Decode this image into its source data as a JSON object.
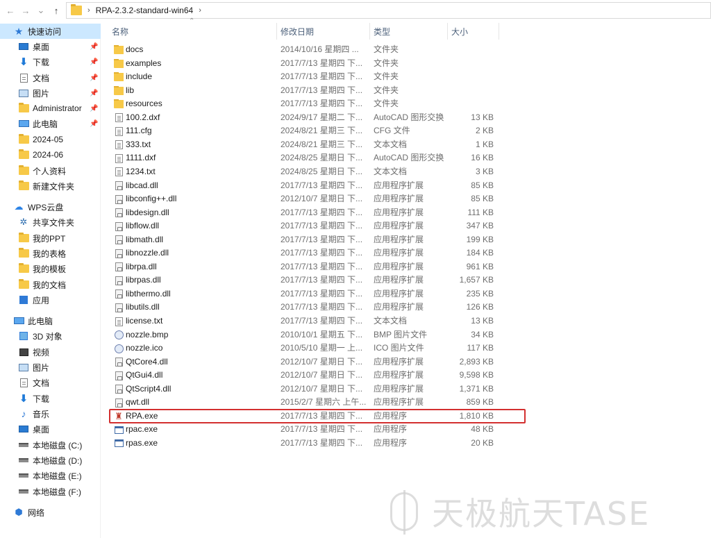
{
  "address": {
    "path": "RPA-2.3.2-standard-win64",
    "back_glyph": "←",
    "forward_glyph": "→",
    "history_glyph": "⌄",
    "up_glyph": "↑",
    "sep_glyph": "›"
  },
  "columns": {
    "name": "名称",
    "date": "修改日期",
    "type": "类型",
    "size": "大小",
    "sort_glyph": "⌃"
  },
  "sidebar": [
    {
      "label": "快速访问",
      "icon": "star-icon",
      "indent": 0,
      "pinned": false,
      "selected": true
    },
    {
      "label": "桌面",
      "icon": "desktop-icon",
      "indent": 1,
      "pinned": true,
      "selected": false
    },
    {
      "label": "下载",
      "icon": "download-icon",
      "indent": 1,
      "pinned": true,
      "selected": false
    },
    {
      "label": "文档",
      "icon": "document-icon",
      "indent": 1,
      "pinned": true,
      "selected": false
    },
    {
      "label": "图片",
      "icon": "pictures-icon",
      "indent": 1,
      "pinned": true,
      "selected": false
    },
    {
      "label": "Administrator",
      "icon": "folder-icon",
      "indent": 1,
      "pinned": true,
      "selected": false
    },
    {
      "label": "此电脑",
      "icon": "computer-icon",
      "indent": 1,
      "pinned": true,
      "selected": false
    },
    {
      "label": "2024-05",
      "icon": "folder-icon",
      "indent": 1,
      "pinned": false,
      "selected": false
    },
    {
      "label": "2024-06",
      "icon": "folder-icon",
      "indent": 1,
      "pinned": false,
      "selected": false
    },
    {
      "label": "个人资料",
      "icon": "folder-icon",
      "indent": 1,
      "pinned": false,
      "selected": false
    },
    {
      "label": "新建文件夹",
      "icon": "folder-icon",
      "indent": 1,
      "pinned": false,
      "selected": false
    },
    {
      "label": "WPS云盘",
      "icon": "cloud-icon",
      "indent": 0,
      "pinned": false,
      "selected": false
    },
    {
      "label": "共享文件夹",
      "icon": "share-icon",
      "indent": 1,
      "pinned": false,
      "selected": false
    },
    {
      "label": "我的PPT",
      "icon": "folder-icon",
      "indent": 1,
      "pinned": false,
      "selected": false
    },
    {
      "label": "我的表格",
      "icon": "folder-icon",
      "indent": 1,
      "pinned": false,
      "selected": false
    },
    {
      "label": "我的模板",
      "icon": "folder-icon",
      "indent": 1,
      "pinned": false,
      "selected": false
    },
    {
      "label": "我的文档",
      "icon": "folder-icon",
      "indent": 1,
      "pinned": false,
      "selected": false
    },
    {
      "label": "应用",
      "icon": "apps-icon",
      "indent": 1,
      "pinned": false,
      "selected": false
    },
    {
      "label": "此电脑",
      "icon": "computer-icon",
      "indent": 0,
      "pinned": false,
      "selected": false
    },
    {
      "label": "3D 对象",
      "icon": "3d-objects-icon",
      "indent": 1,
      "pinned": false,
      "selected": false
    },
    {
      "label": "视频",
      "icon": "video-icon",
      "indent": 1,
      "pinned": false,
      "selected": false
    },
    {
      "label": "图片",
      "icon": "pictures-icon",
      "indent": 1,
      "pinned": false,
      "selected": false
    },
    {
      "label": "文档",
      "icon": "document-icon",
      "indent": 1,
      "pinned": false,
      "selected": false
    },
    {
      "label": "下载",
      "icon": "download-icon",
      "indent": 1,
      "pinned": false,
      "selected": false
    },
    {
      "label": "音乐",
      "icon": "music-icon",
      "indent": 1,
      "pinned": false,
      "selected": false
    },
    {
      "label": "桌面",
      "icon": "desktop-icon",
      "indent": 1,
      "pinned": false,
      "selected": false
    },
    {
      "label": "本地磁盘 (C:)",
      "icon": "drive-icon",
      "indent": 1,
      "pinned": false,
      "selected": false
    },
    {
      "label": "本地磁盘 (D:)",
      "icon": "drive-icon",
      "indent": 1,
      "pinned": false,
      "selected": false
    },
    {
      "label": "本地磁盘 (E:)",
      "icon": "drive-icon",
      "indent": 1,
      "pinned": false,
      "selected": false
    },
    {
      "label": "本地磁盘 (F:)",
      "icon": "drive-icon",
      "indent": 1,
      "pinned": false,
      "selected": false
    },
    {
      "label": "网络",
      "icon": "network-icon",
      "indent": 0,
      "pinned": false,
      "selected": false
    }
  ],
  "pin_glyph": "📌",
  "files": [
    {
      "name": "docs",
      "date": "2014/10/16 星期四 ...",
      "type": "文件夹",
      "size": "",
      "icon": "folder-icon"
    },
    {
      "name": "examples",
      "date": "2017/7/13 星期四 下...",
      "type": "文件夹",
      "size": "",
      "icon": "folder-icon"
    },
    {
      "name": "include",
      "date": "2017/7/13 星期四 下...",
      "type": "文件夹",
      "size": "",
      "icon": "folder-icon"
    },
    {
      "name": "lib",
      "date": "2017/7/13 星期四 下...",
      "type": "文件夹",
      "size": "",
      "icon": "folder-icon"
    },
    {
      "name": "resources",
      "date": "2017/7/13 星期四 下...",
      "type": "文件夹",
      "size": "",
      "icon": "folder-icon"
    },
    {
      "name": "100.2.dxf",
      "date": "2024/9/17 星期二 下...",
      "type": "AutoCAD 图形交换",
      "size": "13 KB",
      "icon": "text-file-icon"
    },
    {
      "name": "111.cfg",
      "date": "2024/8/21 星期三 下...",
      "type": "CFG 文件",
      "size": "2 KB",
      "icon": "text-file-icon"
    },
    {
      "name": "333.txt",
      "date": "2024/8/21 星期三 下...",
      "type": "文本文档",
      "size": "1 KB",
      "icon": "text-file-icon"
    },
    {
      "name": "1111.dxf",
      "date": "2024/8/25 星期日 下...",
      "type": "AutoCAD 图形交换",
      "size": "16 KB",
      "icon": "text-file-icon"
    },
    {
      "name": "1234.txt",
      "date": "2024/8/25 星期日 下...",
      "type": "文本文档",
      "size": "3 KB",
      "icon": "text-file-icon"
    },
    {
      "name": "libcad.dll",
      "date": "2017/7/13 星期四 下...",
      "type": "应用程序扩展",
      "size": "85 KB",
      "icon": "dll-file-icon"
    },
    {
      "name": "libconfig++.dll",
      "date": "2012/10/7 星期日 下...",
      "type": "应用程序扩展",
      "size": "85 KB",
      "icon": "dll-file-icon"
    },
    {
      "name": "libdesign.dll",
      "date": "2017/7/13 星期四 下...",
      "type": "应用程序扩展",
      "size": "111 KB",
      "icon": "dll-file-icon"
    },
    {
      "name": "libflow.dll",
      "date": "2017/7/13 星期四 下...",
      "type": "应用程序扩展",
      "size": "347 KB",
      "icon": "dll-file-icon"
    },
    {
      "name": "libmath.dll",
      "date": "2017/7/13 星期四 下...",
      "type": "应用程序扩展",
      "size": "199 KB",
      "icon": "dll-file-icon"
    },
    {
      "name": "libnozzle.dll",
      "date": "2017/7/13 星期四 下...",
      "type": "应用程序扩展",
      "size": "184 KB",
      "icon": "dll-file-icon"
    },
    {
      "name": "librpa.dll",
      "date": "2017/7/13 星期四 下...",
      "type": "应用程序扩展",
      "size": "961 KB",
      "icon": "dll-file-icon"
    },
    {
      "name": "librpas.dll",
      "date": "2017/7/13 星期四 下...",
      "type": "应用程序扩展",
      "size": "1,657 KB",
      "icon": "dll-file-icon"
    },
    {
      "name": "libthermo.dll",
      "date": "2017/7/13 星期四 下...",
      "type": "应用程序扩展",
      "size": "235 KB",
      "icon": "dll-file-icon"
    },
    {
      "name": "libutils.dll",
      "date": "2017/7/13 星期四 下...",
      "type": "应用程序扩展",
      "size": "126 KB",
      "icon": "dll-file-icon"
    },
    {
      "name": "license.txt",
      "date": "2017/7/13 星期四 下...",
      "type": "文本文档",
      "size": "13 KB",
      "icon": "text-file-icon"
    },
    {
      "name": "nozzle.bmp",
      "date": "2010/10/1 星期五 下...",
      "type": "BMP 图片文件",
      "size": "34 KB",
      "icon": "image-file-icon"
    },
    {
      "name": "nozzle.ico",
      "date": "2010/5/10 星期一 上...",
      "type": "ICO 图片文件",
      "size": "117 KB",
      "icon": "image-file-icon"
    },
    {
      "name": "QtCore4.dll",
      "date": "2012/10/7 星期日 下...",
      "type": "应用程序扩展",
      "size": "2,893 KB",
      "icon": "dll-file-icon"
    },
    {
      "name": "QtGui4.dll",
      "date": "2012/10/7 星期日 下...",
      "type": "应用程序扩展",
      "size": "9,598 KB",
      "icon": "dll-file-icon"
    },
    {
      "name": "QtScript4.dll",
      "date": "2012/10/7 星期日 下...",
      "type": "应用程序扩展",
      "size": "1,371 KB",
      "icon": "dll-file-icon"
    },
    {
      "name": "qwt.dll",
      "date": "2015/2/7 星期六 上午...",
      "type": "应用程序扩展",
      "size": "859 KB",
      "icon": "dll-file-icon"
    },
    {
      "name": "RPA.exe",
      "date": "2017/7/13 星期四 下...",
      "type": "应用程序",
      "size": "1,810 KB",
      "icon": "rpa-app-icon"
    },
    {
      "name": "rpac.exe",
      "date": "2017/7/13 星期四 下...",
      "type": "应用程序",
      "size": "48 KB",
      "icon": "exe-file-icon"
    },
    {
      "name": "rpas.exe",
      "date": "2017/7/13 星期四 下...",
      "type": "应用程序",
      "size": "20 KB",
      "icon": "exe-file-icon"
    }
  ],
  "highlight_color": "#d32f2f",
  "watermark": "天极航天TASE"
}
